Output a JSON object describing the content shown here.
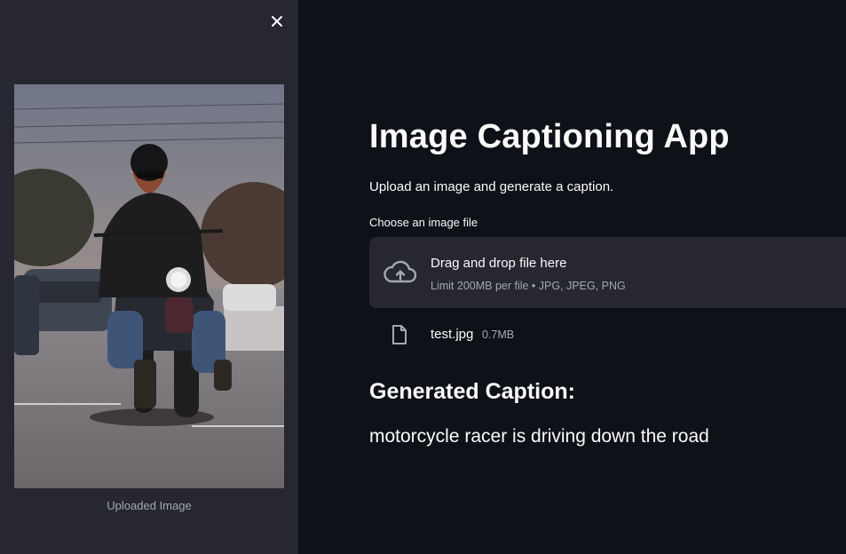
{
  "sidebar": {
    "image_caption": "Uploaded Image",
    "close_icon": "close-icon"
  },
  "main": {
    "title": "Image Captioning App",
    "subtitle": "Upload an image and generate a caption.",
    "uploader": {
      "label": "Choose an image file",
      "drop_title": "Drag and drop file here",
      "drop_subtitle": "Limit 200MB per file • JPG, JPEG, PNG",
      "icon": "cloud-upload-icon"
    },
    "file": {
      "name": "test.jpg",
      "size": "0.7MB",
      "icon": "file-icon"
    },
    "caption_heading": "Generated Caption:",
    "caption_text": "motorcycle racer is driving down the road"
  },
  "colors": {
    "background": "#0e1117",
    "sidebar": "#262730",
    "dropzone": "#262730",
    "text": "#fafafa",
    "muted": "#a3a8b4"
  }
}
